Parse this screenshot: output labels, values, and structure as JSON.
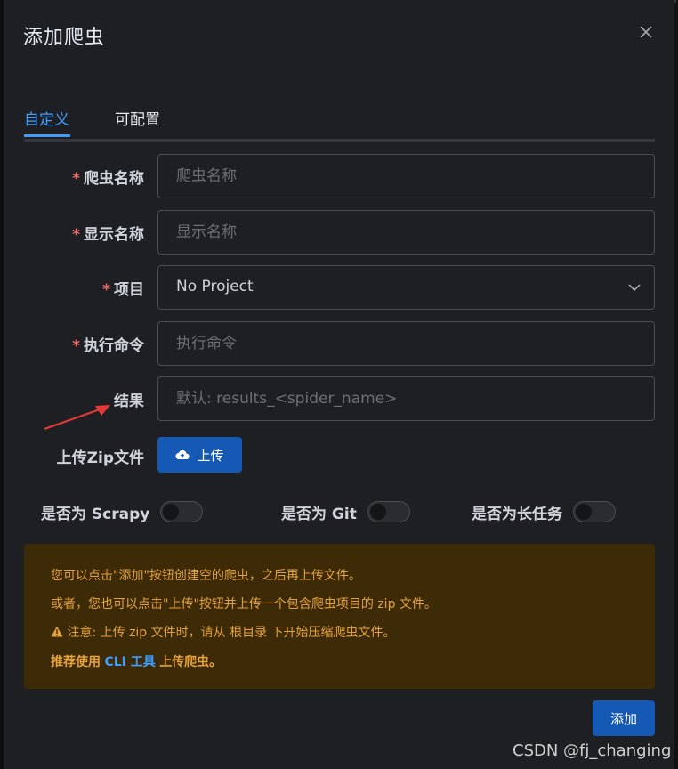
{
  "dialog": {
    "title": "添加爬虫",
    "tabs": [
      {
        "label": "自定义",
        "active": true
      },
      {
        "label": "可配置",
        "active": false
      }
    ]
  },
  "form": {
    "required_mark": "*",
    "spider_name": {
      "label": "爬虫名称",
      "placeholder": "爬虫名称"
    },
    "display_name": {
      "label": "显示名称",
      "placeholder": "显示名称"
    },
    "project": {
      "label": "项目",
      "value": "No Project"
    },
    "command": {
      "label": "执行命令",
      "placeholder": "执行命令"
    },
    "results": {
      "label": "结果",
      "placeholder": "默认: results_<spider_name>"
    },
    "upload": {
      "label": "上传Zip文件",
      "button_label": "上传"
    },
    "toggles": [
      {
        "label": "是否为 Scrapy",
        "on": false
      },
      {
        "label": "是否为 Git",
        "on": false
      },
      {
        "label": "是否为长任务",
        "on": false
      }
    ]
  },
  "alert": {
    "line1": "您可以点击\"添加\"按钮创建空的爬虫，之后再上传文件。",
    "line2": "或者，您也可以点击\"上传\"按钮并上传一个包含爬虫项目的 zip 文件。",
    "line3": "注意: 上传 zip 文件时，请从 根目录 下开始压缩爬虫文件。",
    "line4_prefix": "推荐使用",
    "line4_link": "CLI 工具",
    "line4_suffix": "上传爬虫。"
  },
  "footer": {
    "submit_label": "添加"
  },
  "watermark": "CSDN @fj_changing",
  "colors": {
    "accent": "#409eff",
    "primary_button": "#1559b4",
    "required": "#f56c6c",
    "warning_text": "#e6a23c",
    "warning_bg": "#3d2a06",
    "annotation_arrow": "#e53935"
  }
}
